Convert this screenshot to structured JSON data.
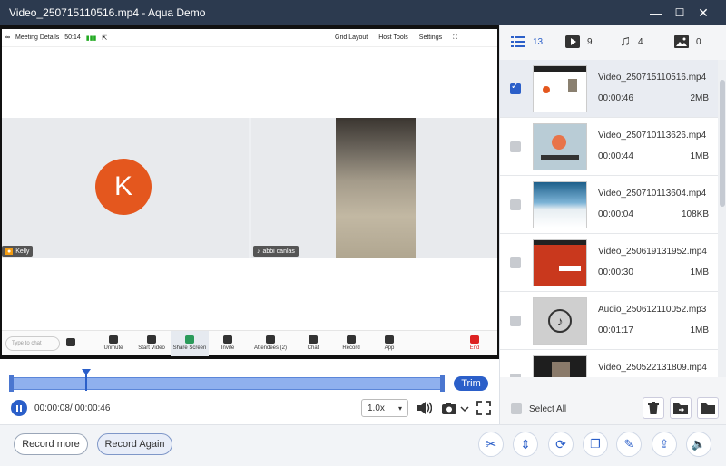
{
  "window": {
    "title": "Video_250715110516.mp4   -   Aqua Demo",
    "minimize": "—",
    "maximize": "☐",
    "close": "✕"
  },
  "meeting": {
    "details_label": "Meeting Details",
    "elapsed": "50:14",
    "grid_layout": "Grid Layout",
    "host_tools": "Host Tools",
    "settings": "Settings",
    "participant1": {
      "initial": "K",
      "name": "Kelly"
    },
    "participant2": {
      "name": "abbi canlas"
    },
    "chat_placeholder": "Type to chat",
    "tools": [
      "Unmute",
      "Start Video",
      "Share Screen",
      "Invite",
      "Attendees (2)",
      "Chat",
      "Record",
      "App"
    ],
    "end_label": "End"
  },
  "player": {
    "trim_label": "Trim",
    "time": "00:00:08/ 00:00:46",
    "speed": "1.0x"
  },
  "buttons": {
    "record_more": "Record more",
    "record_again": "Record Again"
  },
  "panel": {
    "tabs": [
      {
        "icon": "list-icon",
        "count": "13"
      },
      {
        "icon": "video-icon",
        "count": "9"
      },
      {
        "icon": "music-icon",
        "count": "4"
      },
      {
        "icon": "image-icon",
        "count": "0"
      }
    ],
    "files": [
      {
        "name": "Video_250715110516.mp4",
        "duration": "00:00:46",
        "size": "2MB",
        "checked": true
      },
      {
        "name": "Video_250710113626.mp4",
        "duration": "00:00:44",
        "size": "1MB",
        "checked": false
      },
      {
        "name": "Video_250710113604.mp4",
        "duration": "00:00:04",
        "size": "108KB",
        "checked": false
      },
      {
        "name": "Video_250619131952.mp4",
        "duration": "00:00:30",
        "size": "1MB",
        "checked": false
      },
      {
        "name": "Audio_250612110052.mp3",
        "duration": "00:01:17",
        "size": "1MB",
        "checked": false
      },
      {
        "name": "Video_250522131809.mp4",
        "duration": "",
        "size": "",
        "checked": false
      }
    ],
    "select_all": "Select All"
  },
  "colors": {
    "accent": "#2b5fc9",
    "titlebar": "#2c3a4f",
    "avatar": "#e4571e"
  },
  "progress": {
    "playhead_fraction": 0.174
  }
}
